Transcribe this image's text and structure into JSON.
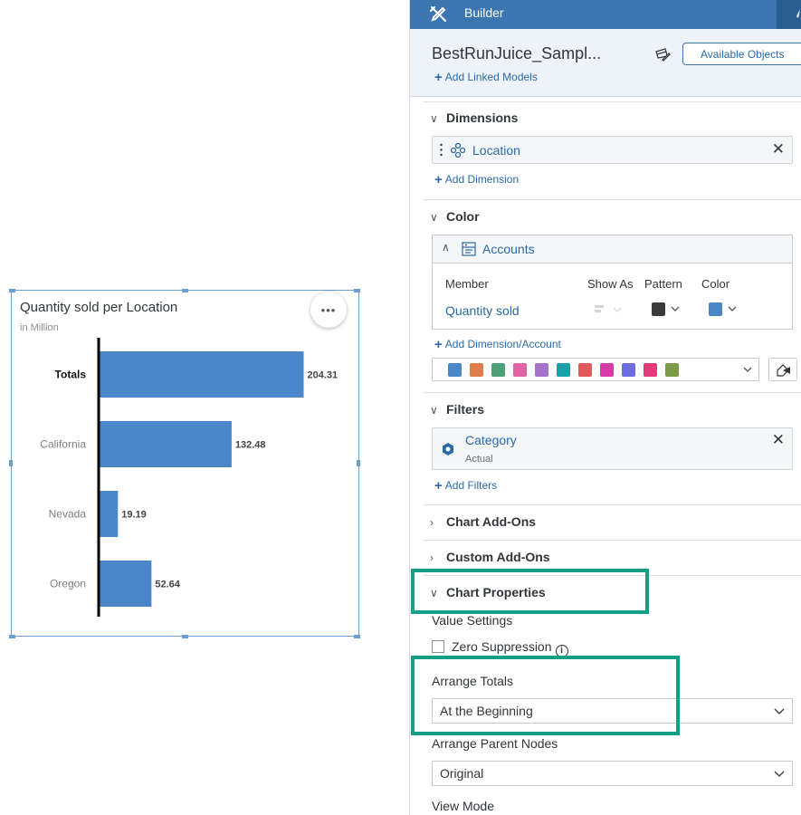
{
  "chart": {
    "title": "Quantity sold per Location",
    "subtitle": "in Million",
    "more_label": "•••"
  },
  "chart_data": {
    "type": "bar",
    "orientation": "horizontal",
    "title": "Quantity sold per Location",
    "subtitle": "in Million",
    "categories": [
      "Totals",
      "California",
      "Nevada",
      "Oregon"
    ],
    "values": [
      204.31,
      132.48,
      19.19,
      52.64
    ],
    "value_labels": [
      "204.31",
      "132.48",
      "19.19",
      "52.64"
    ],
    "bar_color": "#4a86c8",
    "xlim": [
      0,
      230
    ],
    "grid": false,
    "legend": "none"
  },
  "builder": {
    "title": "Builder",
    "model_name": "BestRunJuice_Sampl...",
    "available_objects": "Available Objects",
    "add_linked_models": "Add Linked Models",
    "dimensions": {
      "heading": "Dimensions",
      "item": "Location",
      "add_label": "Add Dimension"
    },
    "color": {
      "heading": "Color",
      "accounts_label": "Accounts",
      "col_member": "Member",
      "col_show_as": "Show As",
      "col_pattern": "Pattern",
      "col_color": "Color",
      "member_value": "Quantity sold",
      "pattern_color": "#3a3a3a",
      "member_color": "#4a86c8",
      "add_label": "Add Dimension/Account",
      "palette": [
        "#4a86c8",
        "#e07b4a",
        "#4e9e78",
        "#e063a8",
        "#a374c9",
        "#1aa0a8",
        "#e05a5a",
        "#d63ca8",
        "#6c6ce0",
        "#e03c7c",
        "#7a9a48"
      ]
    },
    "filters": {
      "heading": "Filters",
      "item": "Category",
      "item_sub": "Actual",
      "add_label": "Add Filters"
    },
    "chart_addons": "Chart Add-Ons",
    "custom_addons": "Custom Add-Ons",
    "chart_properties": {
      "heading": "Chart Properties",
      "value_settings": "Value Settings",
      "zero_suppression": "Zero Suppression",
      "arrange_totals_label": "Arrange Totals",
      "arrange_totals_value": "At the Beginning",
      "arrange_parent_label": "Arrange Parent Nodes",
      "arrange_parent_value": "Original",
      "view_mode_label": "View Mode"
    },
    "highlight_color": "#14a085"
  }
}
